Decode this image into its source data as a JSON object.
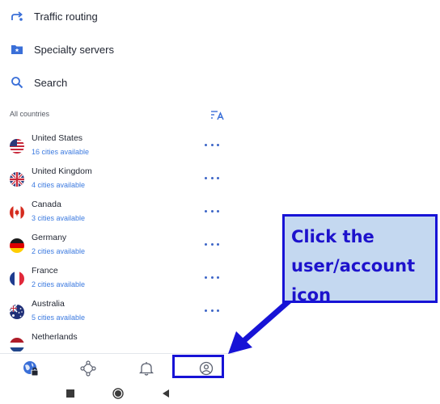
{
  "menu": {
    "traffic_routing": "Traffic routing",
    "specialty_servers": "Specialty servers",
    "search": "Search"
  },
  "list_header": {
    "label": "All countries",
    "sort_icon": "sort-alphabetical-icon"
  },
  "countries": [
    {
      "name": "United States",
      "cities": "16 cities available",
      "flag": "us-flag-icon"
    },
    {
      "name": "United Kingdom",
      "cities": "4 cities available",
      "flag": "uk-flag-icon"
    },
    {
      "name": "Canada",
      "cities": "3 cities available",
      "flag": "canada-flag-icon"
    },
    {
      "name": "Germany",
      "cities": "2 cities available",
      "flag": "germany-flag-icon"
    },
    {
      "name": "France",
      "cities": "2 cities available",
      "flag": "france-flag-icon"
    },
    {
      "name": "Australia",
      "cities": "5 cities available",
      "flag": "australia-flag-icon"
    },
    {
      "name": "Netherlands",
      "cities": "",
      "flag": "netherlands-flag-icon"
    }
  ],
  "bottom_nav": {
    "items": [
      "globe-lock-icon",
      "network-nodes-icon",
      "bell-icon",
      "user-account-icon"
    ]
  },
  "annotation": {
    "line1": "Click the",
    "line2": "user/account",
    "line3": "icon"
  },
  "colors": {
    "accent": "#3d7be0",
    "annotation_blue": "#1713d6",
    "annotation_fill": "#c4d8f0"
  }
}
